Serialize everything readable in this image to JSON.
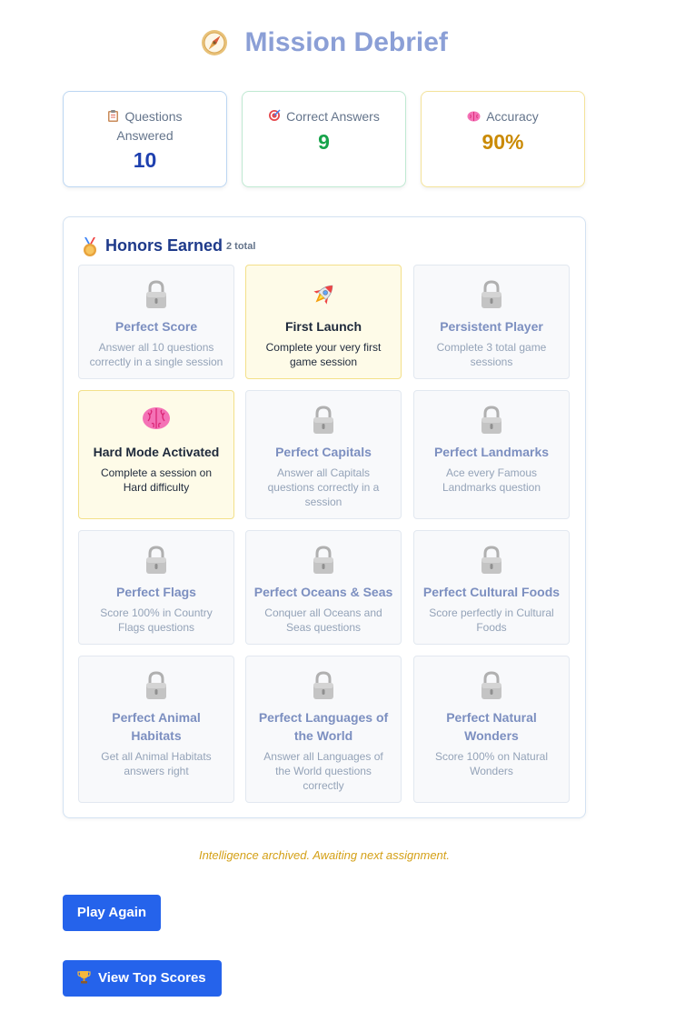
{
  "header": {
    "title": "Mission Debrief",
    "icon": "compass-icon"
  },
  "stats": [
    {
      "icon": "clipboard-icon",
      "label": "Questions Answered",
      "value": "10",
      "color": "#1e40af"
    },
    {
      "icon": "target-icon",
      "label": "Correct Answers",
      "value": "9",
      "color": "#16a34a"
    },
    {
      "icon": "brain-icon",
      "label": "Accuracy",
      "value": "90%",
      "color": "#ca8a04"
    }
  ],
  "honors": {
    "title": "Honors Earned",
    "count": "2 total",
    "icon": "medal-icon",
    "items": [
      {
        "name": "Perfect Score",
        "desc": "Answer all 10 questions correctly in a single session",
        "unlocked": false,
        "icon": "lock-icon"
      },
      {
        "name": "First Launch",
        "desc": "Complete your very first game session",
        "unlocked": true,
        "icon": "rocket-icon"
      },
      {
        "name": "Persistent Player",
        "desc": "Complete 3 total game sessions",
        "unlocked": false,
        "icon": "lock-icon"
      },
      {
        "name": "Hard Mode Activated",
        "desc": "Complete a session on Hard difficulty",
        "unlocked": true,
        "icon": "brain-icon"
      },
      {
        "name": "Perfect Capitals",
        "desc": "Answer all Capitals questions correctly in a session",
        "unlocked": false,
        "icon": "lock-icon"
      },
      {
        "name": "Perfect Landmarks",
        "desc": "Ace every Famous Landmarks question",
        "unlocked": false,
        "icon": "lock-icon"
      },
      {
        "name": "Perfect Flags",
        "desc": "Score 100% in Country Flags questions",
        "unlocked": false,
        "icon": "lock-icon"
      },
      {
        "name": "Perfect Oceans & Seas",
        "desc": "Conquer all Oceans and Seas questions",
        "unlocked": false,
        "icon": "lock-icon"
      },
      {
        "name": "Perfect Cultural Foods",
        "desc": "Score perfectly in Cultural Foods",
        "unlocked": false,
        "icon": "lock-icon"
      },
      {
        "name": "Perfect Animal Habitats",
        "desc": "Get all Animal Habitats answers right",
        "unlocked": false,
        "icon": "lock-icon"
      },
      {
        "name": "Perfect Languages of the World",
        "desc": "Answer all Languages of the World questions correctly",
        "unlocked": false,
        "icon": "lock-icon"
      },
      {
        "name": "Perfect Natural Wonders",
        "desc": "Score 100% on Natural Wonders",
        "unlocked": false,
        "icon": "lock-icon"
      }
    ]
  },
  "message": "Intelligence archived. Awaiting next assignment.",
  "buttons": {
    "play_again": "Play Again",
    "view_top_scores": "View Top Scores",
    "view_top_scores_icon": "trophy-icon"
  },
  "colors": {
    "accent": "#2563eb",
    "title": "#8b9fd6",
    "unlocked_bg": "#fefbe8",
    "locked_bg": "#f8f9fb",
    "message": "#d4a017"
  }
}
